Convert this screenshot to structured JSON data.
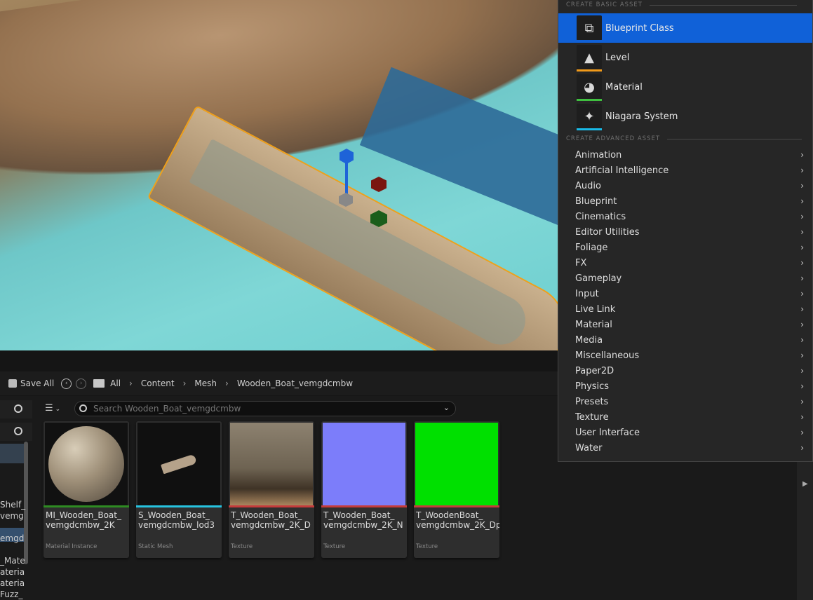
{
  "toolbar": {
    "save_all": "Save All",
    "breadcrumb": [
      "All",
      "Content",
      "Mesh",
      "Wooden_Boat_vemgdcmbw"
    ]
  },
  "search": {
    "placeholder": "Search Wooden_Boat_vemgdcmbw"
  },
  "left_tree": {
    "fragments": [
      "Shelf_",
      "vemg",
      "emgd",
      "_Mate",
      "ateria",
      "ateria",
      "Fuzz_"
    ]
  },
  "assets": [
    {
      "name": "MI_Wooden_Boat_\nvemgdcmbw_2K",
      "type": "Material Instance",
      "color": "#2e8b22"
    },
    {
      "name": "S_Wooden_Boat_\nvemgdcmbw_lod3",
      "type": "Static Mesh",
      "color": "#27c3e0"
    },
    {
      "name": "T_Wooden_Boat_\nvemgdcmbw_2K_D",
      "type": "Texture",
      "color": "#c53b3b"
    },
    {
      "name": "T_Wooden_Boat_\nvemgdcmbw_2K_N",
      "type": "Texture",
      "color": "#c53b3b"
    },
    {
      "name": "T_WoodenBoat_\nvemgdcmbw_2K_DpR",
      "type": "Texture",
      "color": "#c53b3b"
    }
  ],
  "menu": {
    "basic_header": "CREATE BASIC ASSET",
    "basic_items": [
      {
        "label": "Blueprint Class",
        "icon": "blueprint-class-icon",
        "color": "#1061d8"
      },
      {
        "label": "Level",
        "icon": "level-icon",
        "color": "#f09a1a"
      },
      {
        "label": "Material",
        "icon": "material-icon",
        "color": "#3fbf3f"
      },
      {
        "label": "Niagara System",
        "icon": "niagara-system-icon",
        "color": "#19b9e6"
      }
    ],
    "advanced_header": "CREATE ADVANCED ASSET",
    "advanced_items": [
      "Animation",
      "Artificial Intelligence",
      "Audio",
      "Blueprint",
      "Cinematics",
      "Editor Utilities",
      "Foliage",
      "FX",
      "Gameplay",
      "Input",
      "Live Link",
      "Material",
      "Media",
      "Miscellaneous",
      "Paper2D",
      "Physics",
      "Presets",
      "Texture",
      "User Interface",
      "Water"
    ]
  }
}
